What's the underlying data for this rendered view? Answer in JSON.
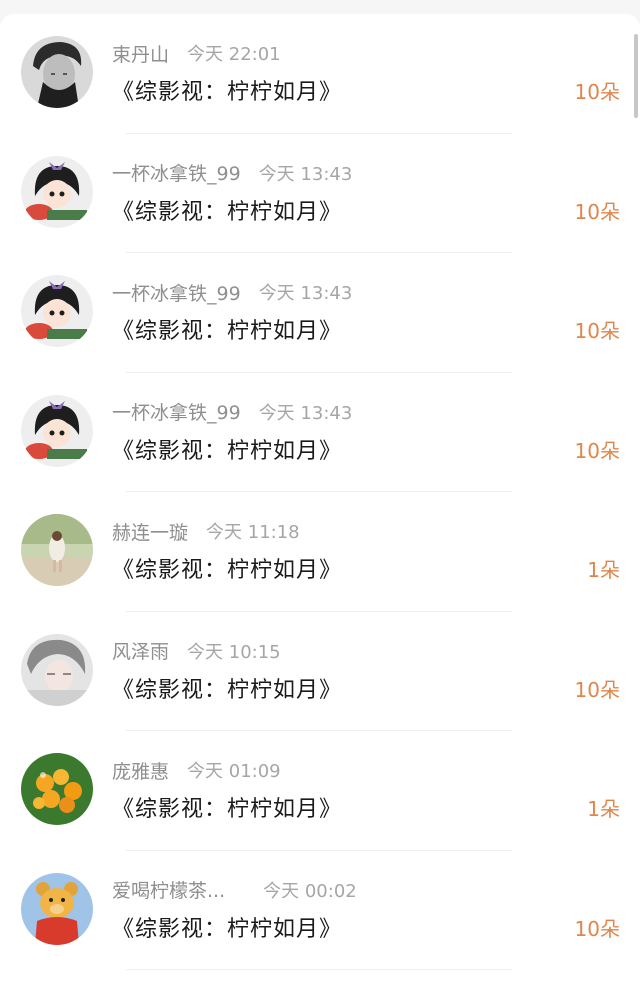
{
  "entries": [
    {
      "user": "束丹山",
      "time": "今天 22:01",
      "title": "《综影视：柠柠如月》",
      "amount": "10朵",
      "avatar": "man-portrait"
    },
    {
      "user": "一杯冰拿铁_99",
      "time": "今天 13:43",
      "title": "《综影视：柠柠如月》",
      "amount": "10朵",
      "avatar": "cartoon-girl"
    },
    {
      "user": "一杯冰拿铁_99",
      "time": "今天 13:43",
      "title": "《综影视：柠柠如月》",
      "amount": "10朵",
      "avatar": "cartoon-girl"
    },
    {
      "user": "一杯冰拿铁_99",
      "time": "今天 13:43",
      "title": "《综影视：柠柠如月》",
      "amount": "10朵",
      "avatar": "cartoon-girl"
    },
    {
      "user": "赫连一璇",
      "time": "今天 11:18",
      "title": "《综影视：柠柠如月》",
      "amount": "1朵",
      "avatar": "girl-outdoors"
    },
    {
      "user": "风泽雨",
      "time": "今天 10:15",
      "title": "《综影视：柠柠如月》",
      "amount": "10朵",
      "avatar": "anime-boy"
    },
    {
      "user": "庞雅惠",
      "time": "今天 01:09",
      "title": "《综影视：柠柠如月》",
      "amount": "1朵",
      "avatar": "orange-fruit"
    },
    {
      "user": "爱喝柠檬茶...",
      "time": "今天 00:02",
      "title": "《综影视：柠柠如月》",
      "amount": "10朵",
      "avatar": "winnie-bear"
    }
  ],
  "colors": {
    "accent": "#e0854b",
    "meta": "#9a9a9a",
    "title": "#1a1a1a"
  }
}
